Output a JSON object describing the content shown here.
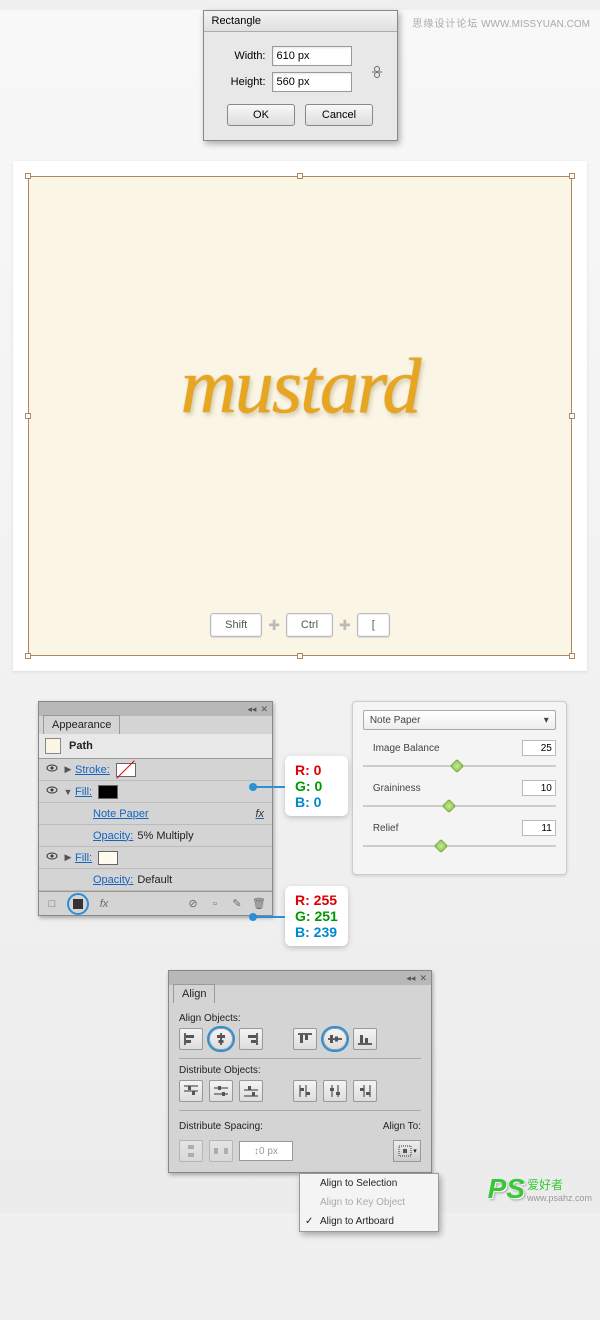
{
  "watermark": {
    "text1": "思缘设计论坛",
    "text2": "WWW.MISSYUAN.COM"
  },
  "rectDialog": {
    "title": "Rectangle",
    "widthLabel": "Width:",
    "widthValue": "610 px",
    "heightLabel": "Height:",
    "heightValue": "560 px",
    "ok": "OK",
    "cancel": "Cancel"
  },
  "canvas": {
    "text": "mustard",
    "keys": {
      "shift": "Shift",
      "ctrl": "Ctrl",
      "bracket": "["
    }
  },
  "appearance": {
    "tab": "Appearance",
    "pathLabel": "Path",
    "strokeLabel": "Stroke:",
    "fillLabel": "Fill:",
    "notePaper": "Note Paper",
    "fx": "fx",
    "opacityLabel": "Opacity:",
    "opacity1": "5% Multiply",
    "opacity2": "Default",
    "footerFx": "fx"
  },
  "rgb1": {
    "r": "R: 0",
    "g": "G: 0",
    "b": "B: 0"
  },
  "rgb2": {
    "r": "R: 255",
    "g": "G: 251",
    "b": "B: 239"
  },
  "notePaper": {
    "select": "Note Paper",
    "imageBalance": "Image Balance",
    "imageBalanceVal": "25",
    "graininess": "Graininess",
    "graininessVal": "10",
    "relief": "Relief",
    "reliefVal": "11"
  },
  "align": {
    "tab": "Align",
    "alignObjects": "Align Objects:",
    "distributeObjects": "Distribute Objects:",
    "distributeSpacing": "Distribute Spacing:",
    "alignTo": "Align To:",
    "spacingValue": "0 px",
    "menu": {
      "selection": "Align to Selection",
      "keyObject": "Align to Key Object",
      "artboard": "Align to Artboard"
    }
  },
  "logo": {
    "ps": "PS",
    "cn": "爱好者",
    "url": "www.psahz.com"
  }
}
